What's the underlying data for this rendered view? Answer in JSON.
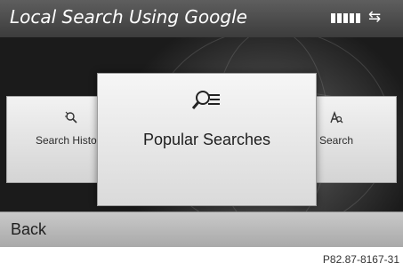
{
  "header": {
    "title": "Local Search Using Google",
    "signal_icon": "signal-strength-icon",
    "connection_icon": "connection-arrows-icon"
  },
  "carousel": {
    "items": [
      {
        "label": "Search History",
        "icon": "search-history-icon"
      },
      {
        "label": "Popular Searches",
        "icon": "popular-searches-icon"
      },
      {
        "label": "Search",
        "icon": "search-icon"
      }
    ],
    "selected_index": 1
  },
  "footer": {
    "back_label": "Back",
    "reference": "P82.87-8167-31"
  }
}
